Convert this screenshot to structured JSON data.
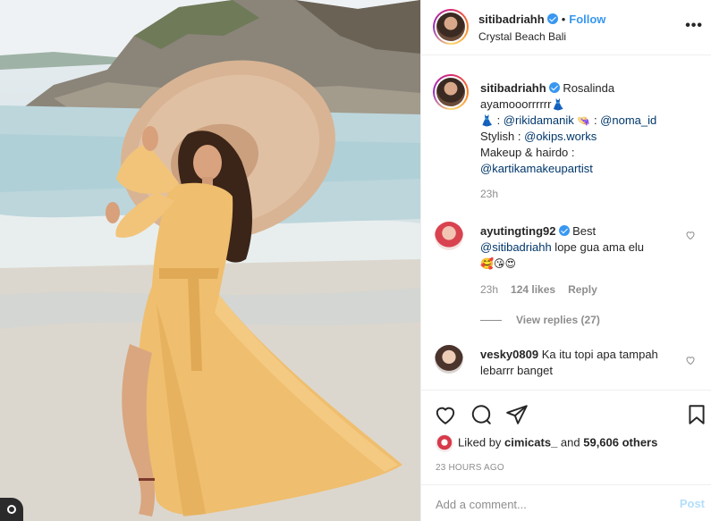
{
  "post": {
    "username": "sitibadriahh",
    "separator": "•",
    "follow_label": "Follow",
    "location": "Crystal Beach Bali",
    "more_icon": "more-horizontal-icon"
  },
  "caption": {
    "username": "sitibadriahh",
    "line1": "Rosalinda",
    "line2": "ayamooorrrrrr",
    "dress_emoji": "👗",
    "line3_sep1": " : ",
    "mention1": "@rikidamanik",
    "hat_emoji": "👒",
    "line3_sep2": " : ",
    "mention2": "@noma_id",
    "stylish_label": "Stylish : ",
    "mention3": "@okips.works",
    "makeup_label": "Makeup & hairdo :",
    "mention4": "@kartikamakeupartist",
    "time": "23h"
  },
  "comments": [
    {
      "username": "ayutingting92",
      "text": "Best",
      "mention": "@sitibadriahh",
      "text2": " lope gua ama elu",
      "emojis": "🥰😘😍",
      "time": "23h",
      "likes": "124 likes",
      "reply_label": "Reply",
      "view_replies": "View replies (27)"
    },
    {
      "username": "vesky0809",
      "text": "Ka itu topi apa tampah lebarrr banget"
    }
  ],
  "actions": {
    "like_icon": "heart-icon",
    "comment_icon": "comment-icon",
    "share_icon": "share-icon",
    "save_icon": "bookmark-icon"
  },
  "likes": {
    "prefix": "Liked by ",
    "user": "cimicats_",
    "middle": " and ",
    "count": "59,606 others"
  },
  "timeago": "23 HOURS AGO",
  "add_comment": {
    "placeholder": "Add a comment...",
    "post_label": "Post"
  },
  "colors": {
    "link": "#00376b",
    "follow": "#3897f0",
    "verified": "#3897f0",
    "muted": "#8e8e8e",
    "post_disabled": "#b2dffc"
  }
}
